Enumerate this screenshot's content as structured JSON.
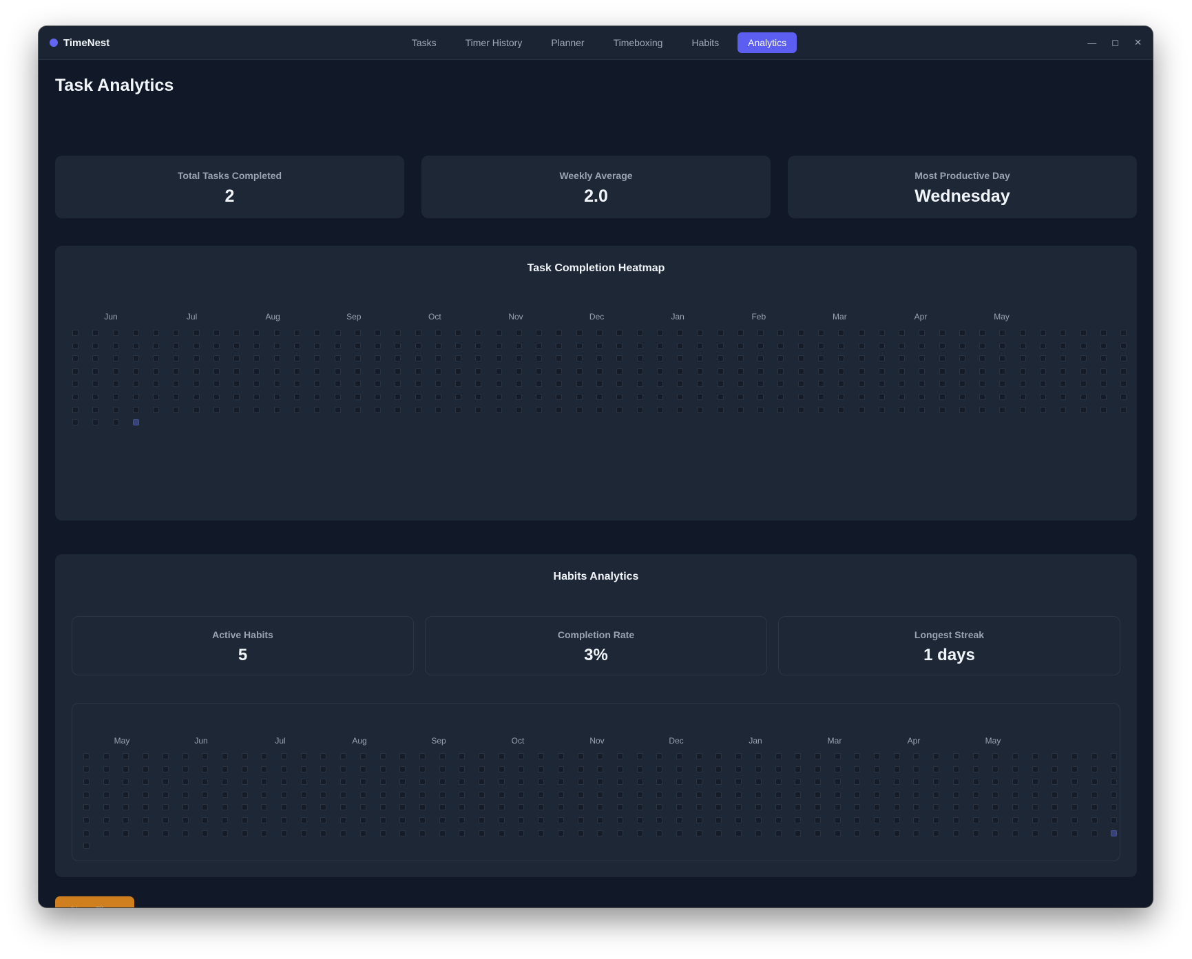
{
  "app": {
    "name": "TimeNest"
  },
  "nav": {
    "items": [
      "Tasks",
      "Timer History",
      "Planner",
      "Timeboxing",
      "Habits",
      "Analytics"
    ],
    "active": "Analytics"
  },
  "window_controls": {
    "minimize": "—",
    "maximize": "◻",
    "close": "✕"
  },
  "page": {
    "title": "Task Analytics"
  },
  "task_stats": [
    {
      "label": "Total Tasks Completed",
      "value": "2"
    },
    {
      "label": "Weekly Average",
      "value": "2.0"
    },
    {
      "label": "Most Productive Day",
      "value": "Wednesday"
    }
  ],
  "task_heatmap": {
    "title": "Task Completion Heatmap",
    "months": [
      "Jun",
      "Jul",
      "Aug",
      "Sep",
      "Oct",
      "Nov",
      "Dec",
      "Jan",
      "Feb",
      "Mar",
      "Apr",
      "May"
    ],
    "weeks": 53,
    "days_per_week": 7,
    "extra_row_cells": 4,
    "active_cells": [
      {
        "week": 3,
        "row": 7
      }
    ]
  },
  "habits": {
    "title": "Habits Analytics",
    "stats": [
      {
        "label": "Active Habits",
        "value": "5"
      },
      {
        "label": "Completion Rate",
        "value": "3%"
      },
      {
        "label": "Longest Streak",
        "value": "1 days"
      }
    ],
    "heatmap": {
      "months": [
        "May",
        "Jun",
        "Jul",
        "Aug",
        "Sep",
        "Oct",
        "Nov",
        "Dec",
        "Jan",
        "Mar",
        "Apr",
        "May"
      ],
      "weeks": 53,
      "days_per_week": 7,
      "extra_row_cells": 1,
      "active_cells": [
        {
          "week": 52,
          "row": 6
        }
      ]
    }
  },
  "buttons": {
    "show_timer": "Show Timer"
  },
  "colors": {
    "accent": "#5b5ef0",
    "background": "#111827",
    "card": "#1e2736",
    "button": "#d07f1f",
    "active_cell": "#374278"
  }
}
